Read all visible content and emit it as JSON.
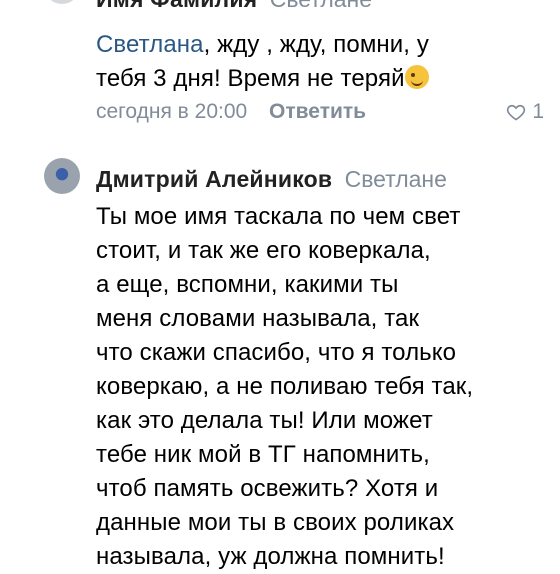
{
  "comments": [
    {
      "author": "Имя Фамилия",
      "reply_to": "Светлане",
      "mention": "Светлана",
      "lines": [
        ", жду , жду, помни, у",
        "тебя 3 дня! Время не теряй"
      ],
      "emoji_name": "wink-emoji-icon",
      "time": "сегодня в 20:00",
      "reply_label": "Ответить",
      "likes": "1"
    },
    {
      "author": "Дмитрий Алейников",
      "reply_to": "Светлане",
      "lines": [
        "Ты мое имя таскала по чем свет",
        "стоит, и так же его коверкала,",
        "а еще, вспомни, какими ты",
        "меня словами называла, так",
        "что скажи спасибо, что я только",
        "коверкаю, а не поливаю тебя так,",
        "как это делала ты! Или может",
        "тебе ник мой в ТГ напомнить,",
        "чтоб память освежить? Хотя и",
        "данные мои ты в своих роликах",
        "называла, уж должна помнить!"
      ]
    }
  ],
  "colors": {
    "mention": "#2a5885",
    "secondary": "#818c99",
    "text": "#000000"
  }
}
